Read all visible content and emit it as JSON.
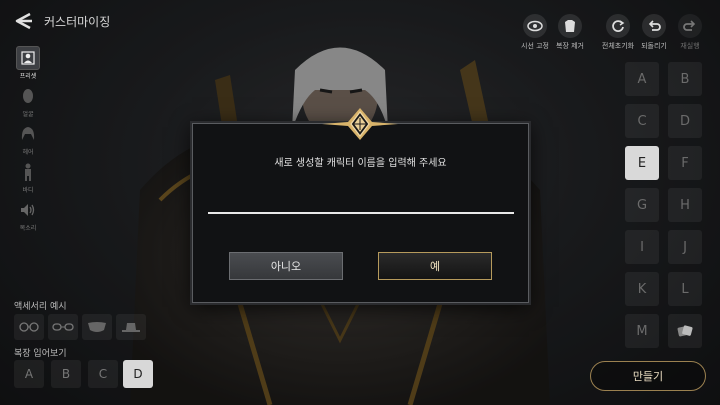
{
  "header": {
    "title": "커스터마이징"
  },
  "top_tools": [
    {
      "label": "시선 고정",
      "icon": "eye-icon"
    },
    {
      "label": "복장 제거",
      "icon": "armor-icon"
    },
    {
      "label": "전체초기화",
      "icon": "reset-icon"
    },
    {
      "label": "되돌리기",
      "icon": "undo-icon"
    },
    {
      "label": "재실행",
      "icon": "redo-icon",
      "disabled": true
    }
  ],
  "left_panel": [
    {
      "label": "프리셋",
      "icon": "preset-icon",
      "active": true
    },
    {
      "label": "얼굴",
      "icon": "face-icon"
    },
    {
      "label": "헤어",
      "icon": "hair-icon"
    },
    {
      "label": "바디",
      "icon": "body-icon"
    },
    {
      "label": "목소리",
      "icon": "voice-icon"
    }
  ],
  "accessory": {
    "label": "액세서리 예시",
    "items": [
      "circle-glasses-icon",
      "glasses-icon",
      "mask-icon",
      "hat-icon"
    ]
  },
  "outfit": {
    "label": "복장 입어보기",
    "options": [
      "A",
      "B",
      "C",
      "D"
    ],
    "selected": "D"
  },
  "preset_grid": {
    "cells": [
      "A",
      "B",
      "C",
      "D",
      "E",
      "F",
      "G",
      "H",
      "I",
      "J",
      "K",
      "L",
      "M"
    ],
    "selected": "E",
    "extra_icon": "random-dice-icon"
  },
  "make_button": "만들기",
  "modal": {
    "message": "새로 생성할 캐릭터 이름을 입력해 주세요",
    "input_value": "",
    "input_placeholder": "",
    "no_label": "아니오",
    "yes_label": "예"
  },
  "colors": {
    "accent_gold": "#b69a5c",
    "active_cell": "#d9d9d9",
    "background": "#1b1d20"
  }
}
